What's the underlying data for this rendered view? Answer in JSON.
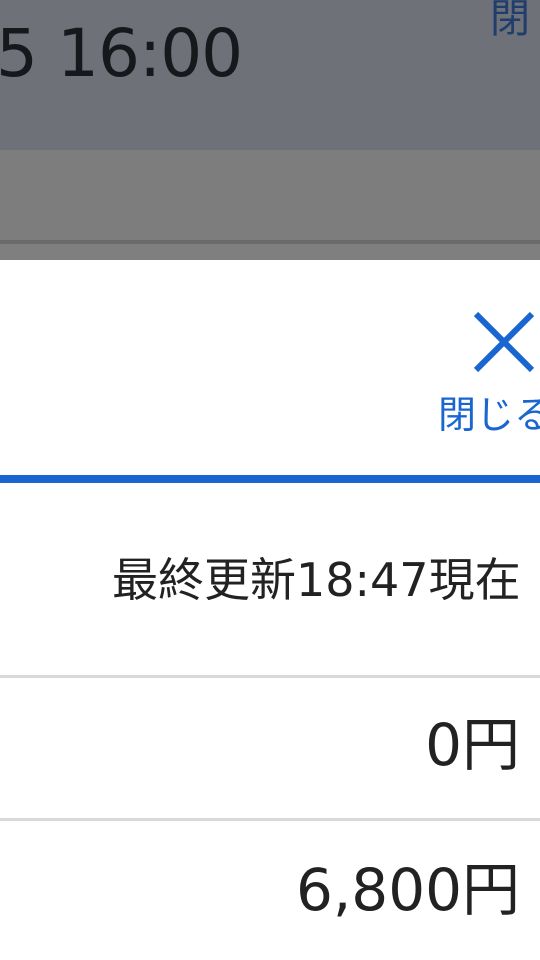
{
  "background": {
    "datetime_fragment": "5 16:00",
    "close_fragment": "閉"
  },
  "modal": {
    "close_label": "閉じる",
    "last_updated": "最終更新18:47現在",
    "rows": [
      {
        "price": "0円"
      },
      {
        "price": "6,800円"
      }
    ]
  },
  "colors": {
    "accent": "#1a66d0",
    "overlay_header": "#6e7178",
    "overlay_band": "#7d7d7d",
    "text": "#222222",
    "divider": "#d9d9d9"
  }
}
